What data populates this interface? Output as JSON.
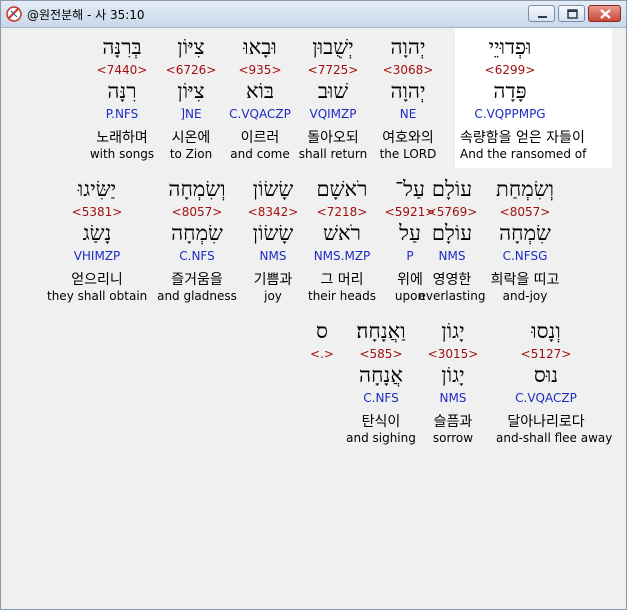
{
  "window": {
    "title": "@원전분해 - 사 35:10"
  },
  "lines": [
    [
      {
        "heb": "וּפְדוּיֵי",
        "strong": "<6299>",
        "root": "פָּדָה",
        "morph": "C.VQPPMPG",
        "kor": "속량함을 얻은 자들이",
        "eng": "And the ransomed of",
        "selected": true
      },
      {
        "heb": "יְהוָה",
        "strong": "<3068>",
        "root": "יְהוָה",
        "morph": "NE",
        "kor": "여호와의",
        "eng": "the LORD"
      },
      {
        "heb": "יְשֻׁבוּן",
        "strong": "<7725>",
        "root": "שׁוּב",
        "morph": "VQIMZP",
        "kor": "돌아오되",
        "eng": "shall return"
      },
      {
        "heb": "וּבָאוּ",
        "strong": "<935>",
        "root": "בּוֹא",
        "morph": "C.VQACZP",
        "kor": "이르러",
        "eng": "and come"
      },
      {
        "heb": "צִיּוֹן",
        "strong": "<6726>",
        "root": "צִיּוֹן",
        "morph": "]NE",
        "kor": "시온에",
        "eng": "to Zion"
      },
      {
        "heb": "בְּרִנָּה",
        "strong": "<7440>",
        "root": "רִנָּה",
        "morph": "P.NFS",
        "kor": "노래하며",
        "eng": "with songs"
      }
    ],
    [
      {
        "heb": "וְשִׂמְחַת",
        "strong": "<8057>",
        "root": "שִׂמְחָה",
        "morph": "C.NFSG",
        "kor": "희락을 띠고",
        "eng": "and-joy"
      },
      {
        "heb": "עוֹלָם",
        "strong": "<5769>",
        "root": "עוֹלָם",
        "morph": "NMS",
        "kor": "영영한",
        "eng": "everlasting"
      },
      {
        "heb": "עַל־",
        "strong": "<5921>",
        "root": "עַל",
        "morph": "P",
        "kor": "위에",
        "eng": "upon"
      },
      {
        "heb": "רֹאשָׁם",
        "strong": "<7218>",
        "root": "רֹאשׁ",
        "morph": "NMS.MZP",
        "kor": "그 머리",
        "eng": "their heads"
      },
      {
        "heb": "שָׂשׂוֹן",
        "strong": "<8342>",
        "root": "שָׂשׂוֹן",
        "morph": "NMS",
        "kor": "기쁨과",
        "eng": "joy"
      },
      {
        "heb": "וְשִׂמְחָה",
        "strong": "<8057>",
        "root": "שִׂמְחָה",
        "morph": "C.NFS",
        "kor": "즐거움을",
        "eng": "and gladness"
      },
      {
        "heb": "יַשִּׂיגוּ",
        "strong": "<5381>",
        "root": "נָשַׂג",
        "morph": "VHIMZP",
        "kor": "얻으리니",
        "eng": "they shall obtain"
      }
    ],
    [
      {
        "heb": "וְנָסוּ",
        "strong": "<5127>",
        "root": "נוּס",
        "morph": "C.VQACZP",
        "kor": "달아나리로다",
        "eng": "and-shall flee away"
      },
      {
        "heb": "יָגוֹן",
        "strong": "<3015>",
        "root": "יָגוֹן",
        "morph": "NMS",
        "kor": "슬픔과",
        "eng": "sorrow"
      },
      {
        "heb": "וַאֲנָחָה׃",
        "strong": "<585>",
        "root": "אֲנָחָה",
        "morph": "C.NFS",
        "kor": "탄식이",
        "eng": "and sighing"
      },
      {
        "heb": "ס",
        "strong": "<.>",
        "root": "",
        "morph": "",
        "kor": "",
        "eng": ""
      }
    ]
  ]
}
